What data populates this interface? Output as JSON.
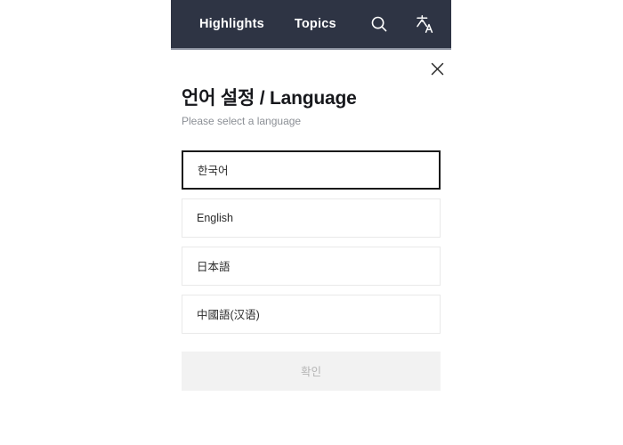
{
  "navbar": {
    "links": [
      {
        "label": "Highlights",
        "name": "nav-link-highlights"
      },
      {
        "label": "Topics",
        "name": "nav-link-topics"
      }
    ],
    "icons": [
      {
        "name": "search-icon",
        "label": "search-icon"
      },
      {
        "name": "translate-icon",
        "label": "translate-icon"
      }
    ],
    "background_color": "#2e3444",
    "text_color": "#ffffff"
  },
  "modal": {
    "close_icon": "close-icon",
    "title": "언어 설정 / Language",
    "subtitle": "Please select a language",
    "options": [
      {
        "label": "한국어",
        "selected": true
      },
      {
        "label": "English",
        "selected": false
      },
      {
        "label": "日本語",
        "selected": false
      },
      {
        "label": "中國語(汉语)",
        "selected": false
      }
    ],
    "confirm_label": "확인",
    "confirm_disabled": true,
    "selected_border_color": "#1a1a1a",
    "option_border_color": "#e9e9e9",
    "confirm_background_color": "#f2f2f2",
    "confirm_text_color": "#b5b5b5"
  }
}
